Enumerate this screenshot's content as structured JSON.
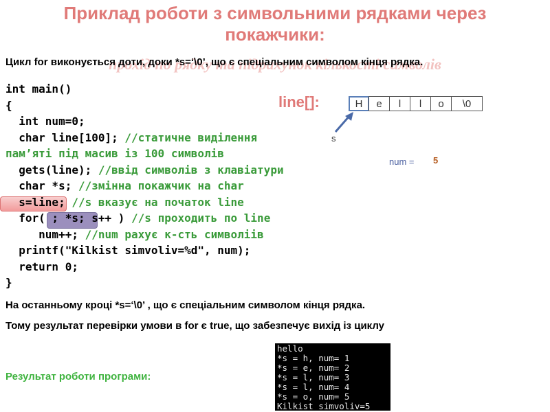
{
  "slide": {
    "title": "Приклад роботи з символьними рядками через покажчики:",
    "subtitle_ghost": "прохід по рядку та підрахунок кількості символів",
    "intro": "Цикл for виконується доти, доки *s=‘\\0’, що є спеціальним символом кінця рядка.",
    "code": {
      "l1": "int main()",
      "l2": "{",
      "l3": "  int num=0;",
      "l4a": "  char line[100]; ",
      "l4b": "//статичне виділення",
      "l5": "пам’яті під масив із 100 символів",
      "l6a": "  gets(line); ",
      "l6b": "//ввід символів з клавіатури",
      "l7a": "  char *s; ",
      "l7b": "//змінна покажчик на char",
      "l8a": "  s=line; ",
      "l8b": "//s вказує на початок line",
      "l9a": "  for( ; *s; s++ ) ",
      "l9b": "//s проходить по line",
      "l10a": "     num++; ",
      "l10b": "//num рахує к-сть символіів",
      "l11": "  printf(\"Kilkist simvoliv=%d\", num);",
      "l12": "  return 0;",
      "l13": "}"
    },
    "line_label": "line[]:",
    "cells": [
      "H",
      "e",
      "l",
      "l",
      "o",
      "\\0"
    ],
    "s_label": "s",
    "num_label": "num =",
    "num_value": "5",
    "paragraph1": "На останньому кроці *s=‘\\0’ , що є спеціальним символом кінця рядка.",
    "paragraph2": "Тому результат перевірки умови в for є true, що забезпечує вихід із циклу",
    "result_label": "Результат роботи програми:",
    "console": [
      "hello",
      "*s = h, num= 1",
      "*s = e, num= 2",
      "*s = l, num= 3",
      "*s = l, num= 4",
      "*s = o, num= 5",
      "Kilkist simvoliv=5"
    ]
  }
}
